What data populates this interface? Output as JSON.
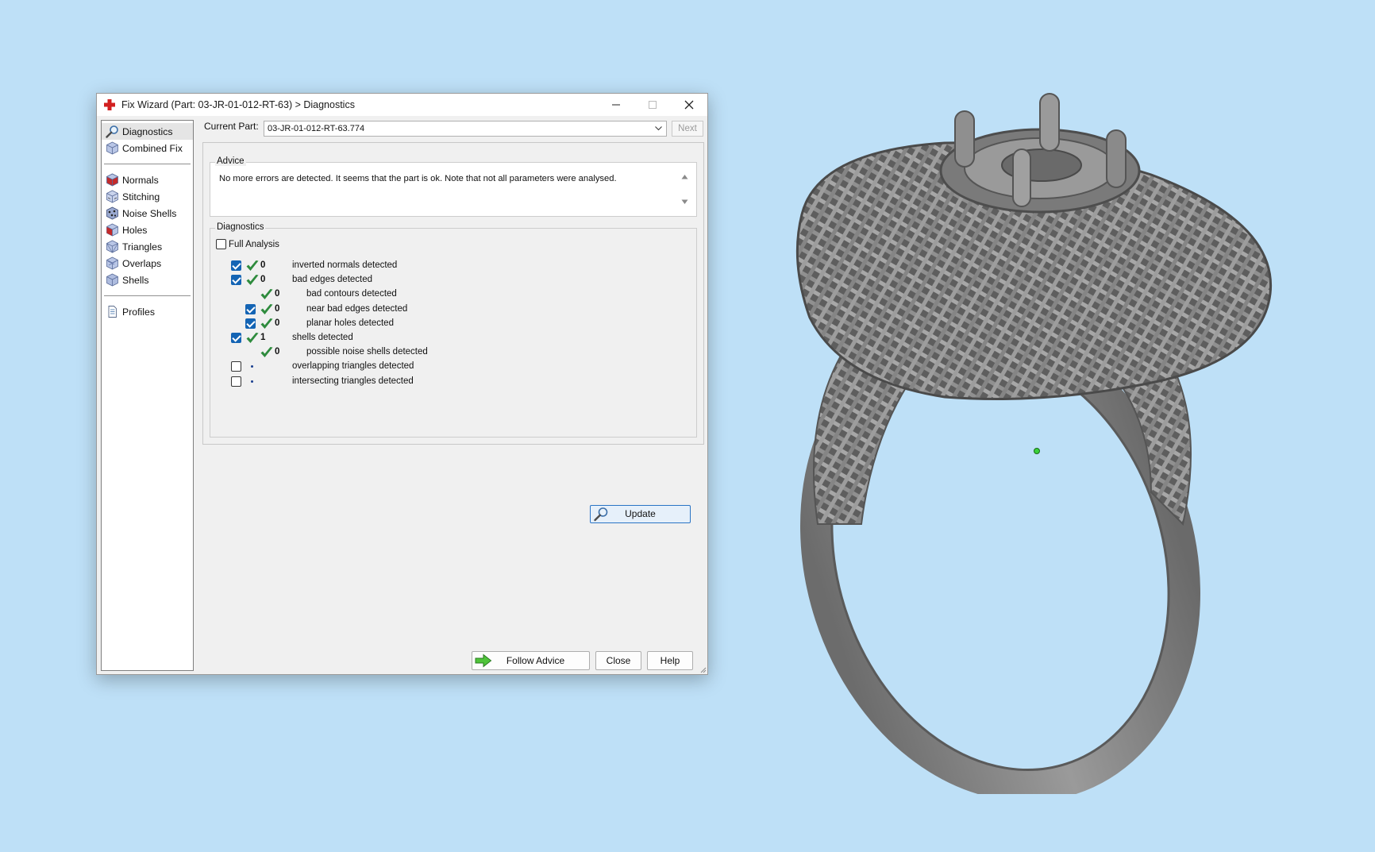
{
  "window": {
    "title": "Fix Wizard (Part: 03-JR-01-012-RT-63) > Diagnostics"
  },
  "nav": {
    "items_top": [
      {
        "label": "Diagnostics",
        "icon": "magnifier-icon"
      },
      {
        "label": "Combined Fix",
        "icon": "cube-icon"
      }
    ],
    "items_mid": [
      {
        "label": "Normals",
        "icon": "cube-icon"
      },
      {
        "label": "Stitching",
        "icon": "cube-icon"
      },
      {
        "label": "Noise Shells",
        "icon": "cube-icon"
      },
      {
        "label": "Holes",
        "icon": "cube-icon"
      },
      {
        "label": "Triangles",
        "icon": "cube-icon"
      },
      {
        "label": "Overlaps",
        "icon": "cube-icon"
      },
      {
        "label": "Shells",
        "icon": "cube-icon"
      }
    ],
    "items_bottom": [
      {
        "label": "Profiles",
        "icon": "document-icon"
      }
    ]
  },
  "current_part": {
    "label": "Current Part:",
    "value": "03-JR-01-012-RT-63.774",
    "next_label": "Next"
  },
  "advice": {
    "title": "Advice",
    "text": "No more errors are detected. It seems that the part is ok. Note that not all parameters were analysed."
  },
  "diagnostics": {
    "title": "Diagnostics",
    "full_analysis_label": "Full Analysis",
    "full_analysis_checked": false,
    "rows": [
      {
        "checked": true,
        "status": "ok",
        "count": "0",
        "label": "inverted normals detected"
      },
      {
        "checked": true,
        "status": "ok",
        "count": "0",
        "label": "bad edges detected"
      },
      {
        "checked": null,
        "status": "ok",
        "count": "0",
        "label": "bad contours detected"
      },
      {
        "checked": true,
        "status": "ok",
        "count": "0",
        "label": "near bad edges detected"
      },
      {
        "checked": true,
        "status": "ok",
        "count": "0",
        "label": "planar holes detected"
      },
      {
        "checked": true,
        "status": "ok",
        "count": "1",
        "label": "shells detected"
      },
      {
        "checked": null,
        "status": "ok",
        "count": "0",
        "label": "possible noise shells detected"
      },
      {
        "checked": false,
        "status": "none",
        "count": "",
        "label": "overlapping triangles detected"
      },
      {
        "checked": false,
        "status": "none",
        "count": "",
        "label": "intersecting triangles detected"
      }
    ],
    "update_label": "Update"
  },
  "buttons": {
    "follow_advice": "Follow Advice",
    "close": "Close",
    "help": "Help"
  },
  "colors": {
    "background": "#bee0f7",
    "accent": "#1464b4",
    "check_green": "#2e8b3d"
  }
}
